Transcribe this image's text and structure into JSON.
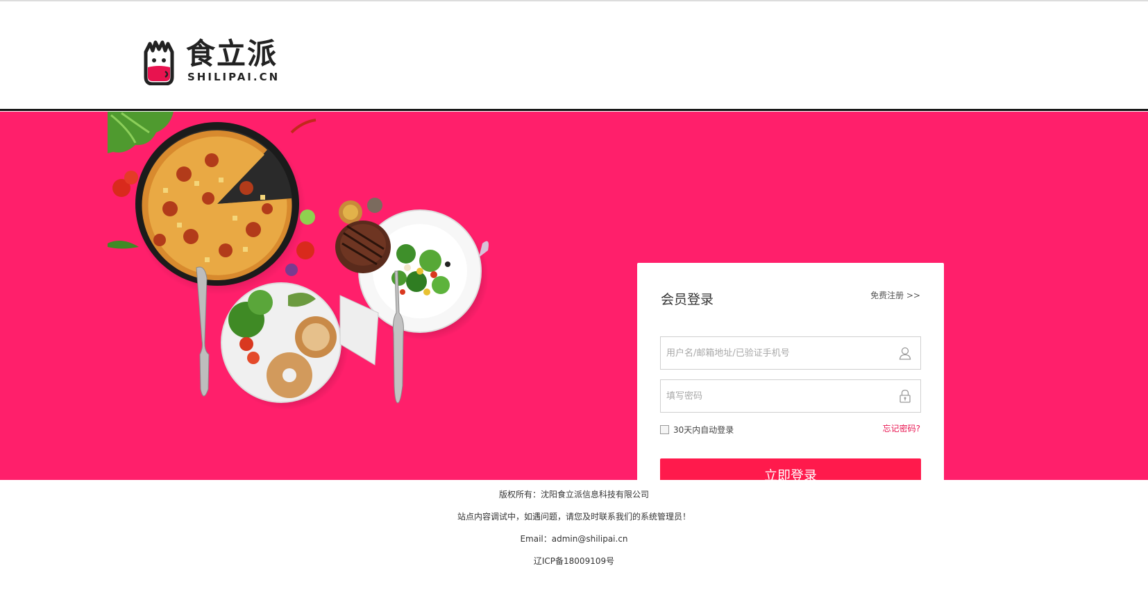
{
  "brand": {
    "name_cn": "食立派",
    "name_en": "SHILIPAI.CN",
    "accent": "#ff1f6b",
    "button": "#ff1a4c"
  },
  "login": {
    "title": "会员登录",
    "register_link": "免费注册 >>",
    "username_placeholder": "用户名/邮箱地址/已验证手机号",
    "password_placeholder": "填写密码",
    "remember_label": "30天内自动登录",
    "forgot_link": "忘记密码?",
    "submit_label": "立即登录",
    "user_icon": "user-icon",
    "lock_icon": "lock-icon"
  },
  "footer": {
    "copyright": "版权所有：沈阳食立派信息科技有限公司",
    "notice": "站点内容调试中，如遇问题，请您及时联系我们的系统管理员！",
    "email": "Email：admin@shilipai.cn",
    "icp": "辽ICP备18009109号"
  }
}
